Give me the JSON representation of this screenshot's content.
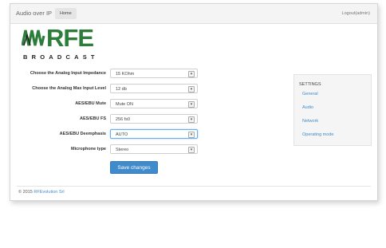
{
  "navbar": {
    "brand": "Audio over IP",
    "home_tab": "Home",
    "logout": "Logout(admin)"
  },
  "logo": {
    "word": "RFE",
    "tagline": "BROADCAST",
    "brand_color": "#2c7d3a"
  },
  "form": {
    "rows": [
      {
        "label": "Choose the Analog Input Impedance",
        "value": "15 KOhm"
      },
      {
        "label": "Choose the Analog Max Input Level",
        "value": "12 db"
      },
      {
        "label": "AES/EBU Mute",
        "value": "Mute ON"
      },
      {
        "label": "AES/EBU FS",
        "value": "256 fs0"
      },
      {
        "label": "AES/EBU Deemphasis",
        "value": "AUTO"
      },
      {
        "label": "Microphone type",
        "value": "Stereo"
      }
    ],
    "save_label": "Save changes"
  },
  "settings": {
    "title": "SETTINGS",
    "items": [
      "General",
      "Audio",
      "Network",
      "Operating mode"
    ]
  },
  "footer": {
    "copyright": "© 2015 ",
    "company": "RFEvolution Srl"
  },
  "colors": {
    "accent": "#428bca",
    "link": "#428bca"
  }
}
